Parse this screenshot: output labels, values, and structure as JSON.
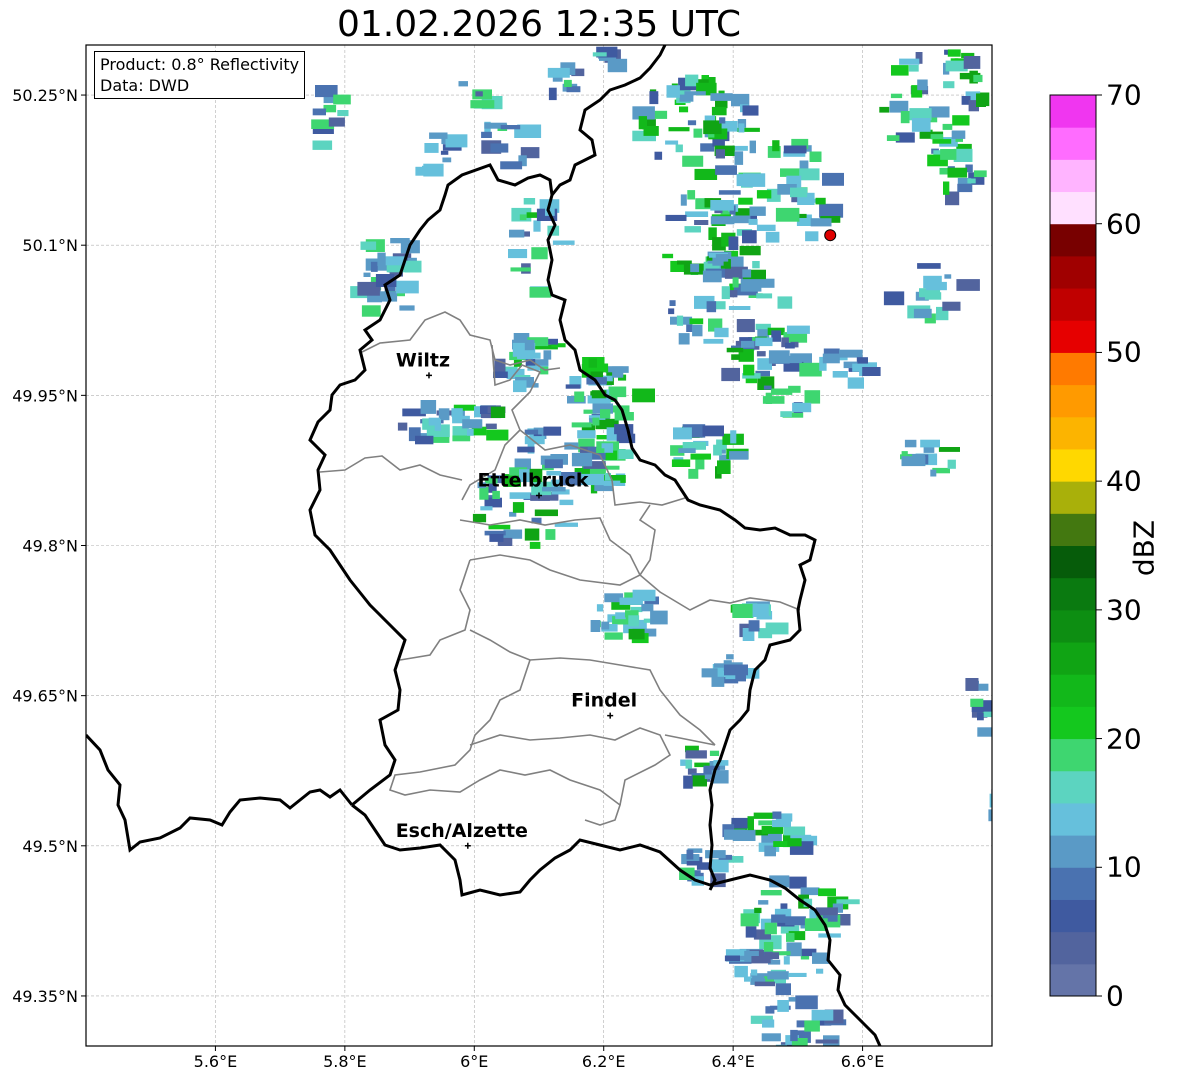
{
  "title": "01.02.2026 12:35 UTC",
  "info": {
    "product": "Product: 0.8° Reflectivity",
    "source": "Data: DWD"
  },
  "map": {
    "lon_range": [
      5.4,
      6.8
    ],
    "lat_range": [
      49.3,
      50.3
    ],
    "lon_ticks": [
      {
        "value": 5.6,
        "label": "5.6°E"
      },
      {
        "value": 5.8,
        "label": "5.8°E"
      },
      {
        "value": 6.0,
        "label": "6°E"
      },
      {
        "value": 6.2,
        "label": "6.2°E"
      },
      {
        "value": 6.4,
        "label": "6.4°E"
      },
      {
        "value": 6.6,
        "label": "6.6°E"
      }
    ],
    "lat_ticks": [
      {
        "value": 50.25,
        "label": "50.25°N"
      },
      {
        "value": 50.1,
        "label": "50.1°N"
      },
      {
        "value": 49.95,
        "label": "49.95°N"
      },
      {
        "value": 49.8,
        "label": "49.8°N"
      },
      {
        "value": 49.65,
        "label": "49.65°N"
      },
      {
        "value": 49.5,
        "label": "49.5°N"
      },
      {
        "value": 49.35,
        "label": "49.35°N"
      }
    ],
    "grid": true,
    "cities": [
      {
        "name": "Wiltz",
        "lon": 5.93,
        "lat": 49.97
      },
      {
        "name": "Ettelbruck",
        "lon": 6.1,
        "lat": 49.85
      },
      {
        "name": "Findel",
        "lon": 6.21,
        "lat": 49.63
      },
      {
        "name": "Esch/Alzette",
        "lon": 5.99,
        "lat": 49.5
      }
    ],
    "radar_site": {
      "lon": 6.55,
      "lat": 50.11,
      "color": "#e00000"
    }
  },
  "colorbar": {
    "label": "dBZ",
    "min": 0,
    "max": 70,
    "step": 2.5,
    "ticks": [
      0,
      10,
      20,
      30,
      40,
      50,
      60,
      70
    ],
    "colors": [
      "#6474a8",
      "#52649e",
      "#3f5aa0",
      "#4a72b0",
      "#5a9ac6",
      "#66c0dc",
      "#5cd4c0",
      "#3ed670",
      "#14c81e",
      "#12b81a",
      "#10a414",
      "#0d8e12",
      "#0a7a10",
      "#065c0a",
      "#437810",
      "#a9b00a",
      "#ffd800",
      "#fcb400",
      "#ff9a00",
      "#ff7a00",
      "#e60000",
      "#c00000",
      "#a00000",
      "#780000",
      "#ffe0ff",
      "#ffb4ff",
      "#ff6cff",
      "#f036f0"
    ]
  }
}
